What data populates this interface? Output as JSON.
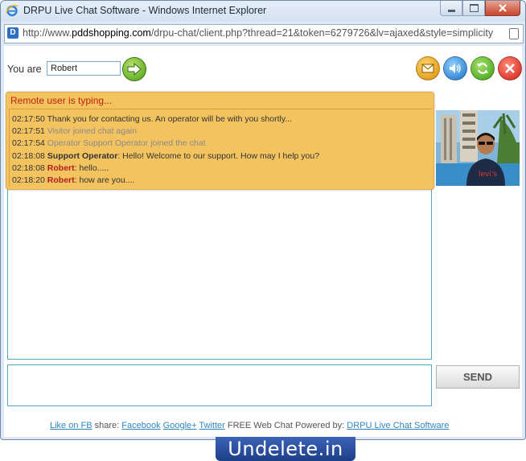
{
  "window": {
    "title": "DRPU Live Chat Software - Windows Internet Explorer",
    "url_prefix": "http://www.",
    "url_domain": "pddshopping.com",
    "url_rest": "/drpu-chat/client.php?thread=21&token=6279726&lv=ajaxed&style=simplicity"
  },
  "header": {
    "you_are_label": "You are",
    "name_value": "Robert"
  },
  "chat": {
    "typing_status": "Remote user is typing...",
    "messages": [
      {
        "time": "02:17:50",
        "sender": "",
        "text": "Thank you for contacting us. An operator will be with you shortly..."
      },
      {
        "time": "02:17:51",
        "sender": "",
        "text": "Visitor joined chat again"
      },
      {
        "time": "02:17:54",
        "sender": "",
        "text": "Operator Support Operator joined the chat"
      },
      {
        "time": "02:18:08",
        "sender": "Support Operator",
        "text": ": Hello! Welcome to our support. How may I help you?"
      },
      {
        "time": "02:18:08",
        "sender": "Robert",
        "text": ": hello....."
      },
      {
        "time": "02:18:20",
        "sender": "Robert",
        "text": ": how are you...."
      }
    ]
  },
  "composer": {
    "send_label": "SEND"
  },
  "footer": {
    "like_fb": "Like on FB",
    "share_label": " share: ",
    "facebook": "Facebook",
    "google": "Google+",
    "twitter": "Twitter",
    "powered_text": " FREE Web Chat Powered by: ",
    "drpu_link": "DRPU Live Chat Software"
  },
  "watermark": {
    "text": "Undelete.in"
  },
  "colors": {
    "typing_panel": "#f3c360",
    "typing_text": "#c0200f",
    "user_name": "#b01e1e",
    "link": "#2f86bd",
    "border_blue": "#5aa6c7"
  }
}
